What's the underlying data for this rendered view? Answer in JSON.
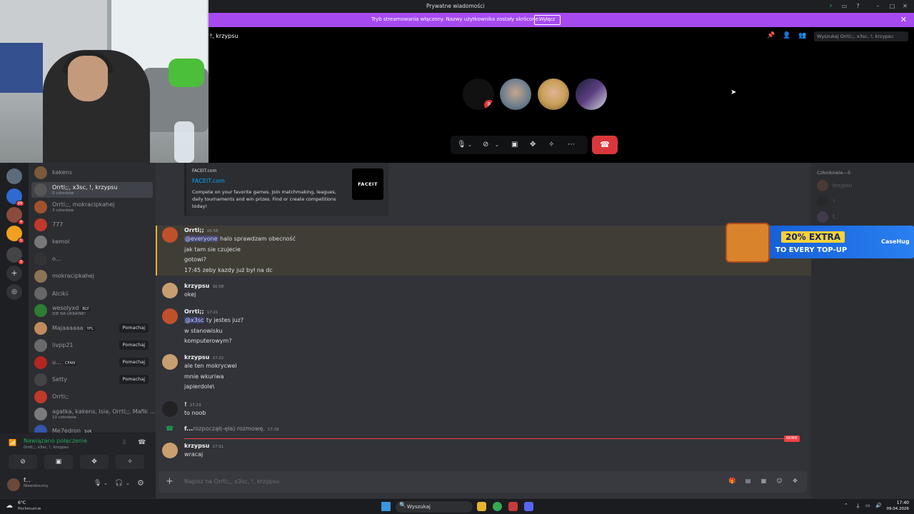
{
  "window": {
    "title": "Prywatne wiadomości"
  },
  "stream_banner": {
    "text": "Tryb streamowania włączony. Nazwy użytkownika zostały skrócone.",
    "button": "Wyłącz"
  },
  "call": {
    "title": "!, krzypsu",
    "search_placeholder": "Wyszukaj Orrti;;, x3sc, !, krzypsu",
    "participants": [
      "participant-muted",
      "participant-2",
      "participant-3",
      "participant-4"
    ]
  },
  "dm_list": [
    {
      "name": "kakens",
      "sub": ""
    },
    {
      "name": "Orrti;;, x3sc, !, krzypsu",
      "sub": "5 członków",
      "active": true
    },
    {
      "name": "Orrti;;, mokracipkahej",
      "sub": "3 członków"
    },
    {
      "name": "777",
      "sub": ""
    },
    {
      "name": "kemol",
      "sub": ""
    },
    {
      "name": "o...",
      "sub": ""
    },
    {
      "name": "mokracipkahej",
      "sub": ""
    },
    {
      "name": "Alcik⸸",
      "sub": ""
    },
    {
      "name": "wesolyxd",
      "sub": "IDE NA UKRAINE!",
      "tag": "BLY"
    },
    {
      "name": "Majaaaaaa",
      "sub": "",
      "tag": "YFL",
      "wave": "Pomachaj"
    },
    {
      "name": "livpp21",
      "sub": "",
      "wave": "Pomachaj"
    },
    {
      "name": "u...",
      "sub": "",
      "tag": "CFAN",
      "wave": "Pomachaj"
    },
    {
      "name": "Setty",
      "sub": "",
      "wave": "Pomachaj"
    },
    {
      "name": "Orrti;;",
      "sub": ""
    },
    {
      "name": "agatka, kakens, Isia, Orrti;;, Mafik ...",
      "sub": "10 członków"
    },
    {
      "name": "Me7edron",
      "sub": "",
      "tag": "SVK"
    }
  ],
  "voice": {
    "status": "Nawiązano połączenie",
    "channel": "Orrti;;, x3sc, !, krzypsu"
  },
  "user": {
    "name": "f...",
    "status": "Niewidoczny"
  },
  "embed": {
    "site": "FACEIT.com",
    "title": "FACEIT.com",
    "description": "Compete on your favorite games. Join matchmaking, leagues, daily tournaments and win prizes. Find or create competitions today!",
    "logo": "FACEIT"
  },
  "messages": [
    {
      "author": "Orrti;;",
      "time": "16:58",
      "lines": [
        "@everyone| halo sprawdzam obecność",
        "jak tam sie czujecie",
        "gotowi?",
        "17:45 zeby kazdy już był na dc"
      ]
    },
    {
      "author": "krzypsu",
      "time": "16:58",
      "lines": [
        "okej"
      ]
    },
    {
      "author": "Orrti;;",
      "time": "17:21",
      "lines": [
        "@x3sc| ty jestes juz?",
        "w stanowisku",
        "komputerowym?"
      ]
    },
    {
      "author": "krzypsu",
      "time": "17:22",
      "lines": [
        "ale ten mokrycwel",
        "mnie wkuriwa",
        "japierdole\\"
      ]
    },
    {
      "author": "!",
      "time": "17:23",
      "lines": [
        "to noob"
      ]
    },
    {
      "author": "f...",
      "time": "17:29",
      "system": "rozpoczął(-ęła) rozmowę."
    },
    {
      "author": "krzypsu",
      "time": "17:31",
      "lines": [
        "wracaj"
      ]
    }
  ],
  "new_badge": "NOWE",
  "composer": {
    "placeholder": "Napisz na Orrti;;, x3sc, !, krzypsu"
  },
  "members": {
    "header": "Członkowie—5",
    "list": [
      "krzypsu",
      "!",
      "f..."
    ]
  },
  "ad": {
    "headline": "20% EXTRA",
    "sub": "TO EVERY TOP-UP",
    "brand": "CaseHug"
  },
  "taskbar": {
    "weather_temp": "6°C",
    "weather_desc": "Pochmurnie",
    "search": "Wyszukaj",
    "time": "17:40",
    "date": "09.04.2026"
  },
  "colors": {
    "accent": "#a64af0",
    "link": "#00a8fc",
    "online": "#23a55a",
    "danger": "#da373c"
  }
}
